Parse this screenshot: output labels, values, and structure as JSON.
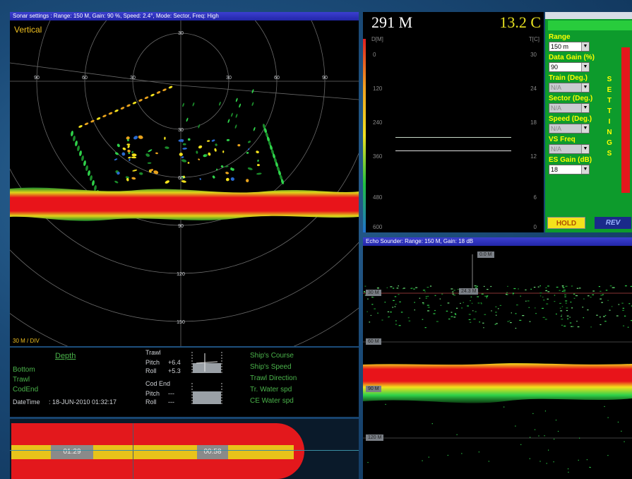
{
  "sonar": {
    "title": "Sonar settings : Range: 150 M, Gain: 90 %, Speed: 2.4°, Mode: Sector, Freq: High",
    "mode_label": "Vertical",
    "scale_label": "30 M / DIV",
    "ring_labels_top": [
      "30",
      "30",
      "60",
      "90"
    ],
    "ring_labels_left": [
      "90",
      "60",
      "30"
    ],
    "ring_labels_right": [
      "30",
      "60",
      "90"
    ],
    "depth_labels": [
      "30",
      "60",
      "90",
      "120",
      "150"
    ]
  },
  "info": {
    "depth_header": "Depth",
    "depth_rows": [
      "Bottom",
      "Trawl",
      "CodEnd"
    ],
    "datetime_label": "DateTime",
    "datetime_value": "18-JUN-2010 01:32:17",
    "trawl_header": "Trawl",
    "trawl_pitch_label": "Pitch",
    "trawl_pitch_value": "+6.4",
    "trawl_roll_label": "Roll",
    "trawl_roll_value": "+5.3",
    "codend_header": "Cod End",
    "codend_pitch_label": "Pitch",
    "codend_pitch_value": "---",
    "codend_roll_label": "Roll",
    "codend_roll_value": "---",
    "ship_rows": [
      "Ship's Course",
      "Ship's Speed",
      "Trawl Direction",
      "Tr. Water spd",
      "CE Water spd"
    ]
  },
  "timeline": {
    "label_left": "01:29",
    "label_right": "00:58"
  },
  "temp_profile": {
    "depth_readout": "291 M",
    "temp_readout": "13.2 C",
    "depth_axis_label": "D[M]",
    "temp_axis_label": "T[C]",
    "depth_ticks": [
      "0",
      "120",
      "240",
      "360",
      "480",
      "600"
    ],
    "temp_ticks": [
      "30",
      "24",
      "18",
      "12",
      "6",
      "0"
    ]
  },
  "controls": {
    "range_label": "Range",
    "range_value": "150 m",
    "gain_label": "Data Gain (%)",
    "gain_value": "90",
    "train_label": "Train (Deg.)",
    "train_value": "N/A",
    "sector_label": "Sector (Deg.)",
    "sector_value": "N/A",
    "speed_label": "Speed (Deg.)",
    "speed_value": "N/A",
    "vsfreq_label": "VS Freq",
    "vsfreq_value": "N/A",
    "esgain_label": "ES Gain (dB)",
    "esgain_value": "18",
    "settings_letters": [
      "S",
      "E",
      "T",
      "T",
      "I",
      "N",
      "G",
      "S"
    ],
    "hold_label": "HOLD",
    "rev_label": "REV"
  },
  "echo": {
    "title": "Echo Sounder: Range: 150 M,   Gain: 18 dB",
    "depth_tags": [
      "30 M",
      "60 M",
      "90 M",
      "120 M"
    ],
    "marker_top": "0.0 M",
    "marker_mid": "24.3 M"
  },
  "colors": {
    "echo_red": "#e8141a",
    "echo_yellow": "#f4e21c",
    "echo_green": "#2fd24a",
    "panel_green": "#0d9b2c",
    "label_yellow": "#ffff00"
  }
}
